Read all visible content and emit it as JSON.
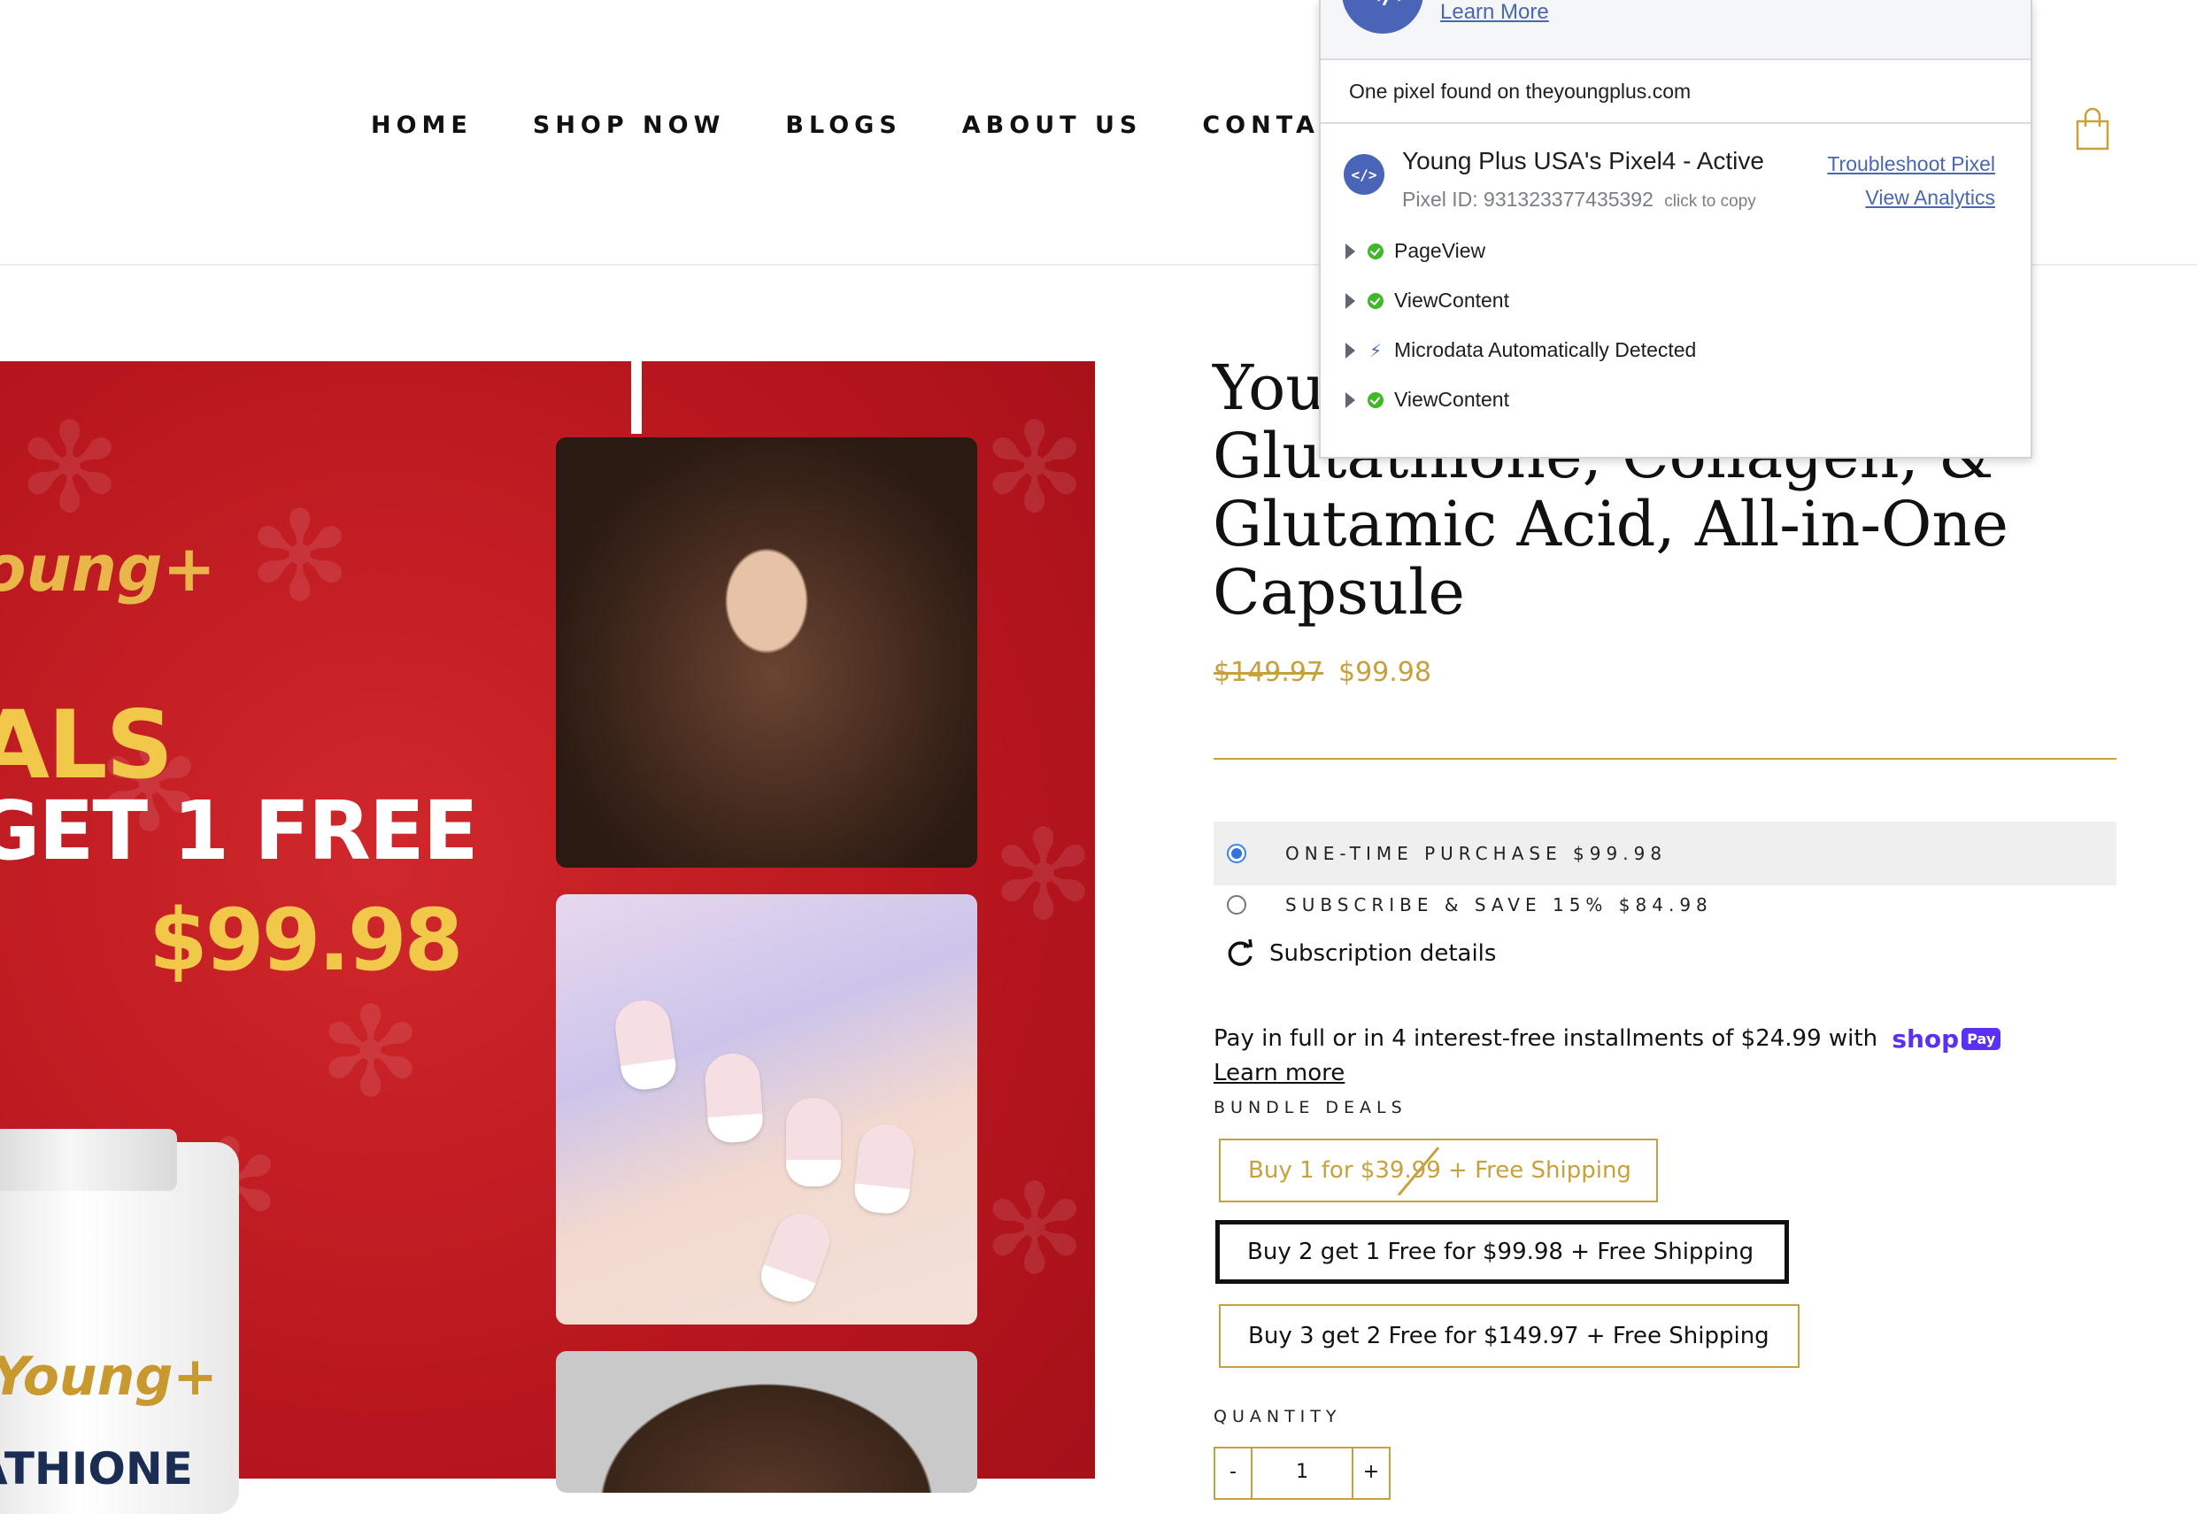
{
  "nav": {
    "items": [
      "HOME",
      "SHOP NOW",
      "BLOGS",
      "ABOUT US",
      "CONTACT U"
    ],
    "cart_icon": "shopping-bag-icon"
  },
  "hero": {
    "brand": "oung+",
    "deal_line1": "ALS",
    "deal_line2": "GET 1 FREE",
    "deal_price": "$99.98",
    "bottle_brand": "Young+",
    "bottle_label": "ATHIONE",
    "colors": {
      "background": "#c0201f",
      "accent": "#f2c84b"
    }
  },
  "product": {
    "title": "Young Plus Glutathione, Collagen, & Glutamic Acid, All-in-One Capsule",
    "title_visible_lines": [
      "You",
      "Glutathione, Collagen, &",
      "Glutamic Acid, All-in-One",
      "Capsule"
    ],
    "price_old": "$149.97",
    "price_new": "$99.98",
    "purchase_options": [
      {
        "label": "ONE-TIME PURCHASE $99.98",
        "selected": true
      },
      {
        "label": "SUBSCRIBE & SAVE 15% $84.98",
        "selected": false
      }
    ],
    "subscription_details": "Subscription details",
    "installments_text": "Pay in full or in 4 interest-free installments of $24.99 with",
    "shop_pay": {
      "shop": "shop",
      "pay": "Pay"
    },
    "learn_more": "Learn more",
    "bundle_label": "BUNDLE DEALS",
    "bundles": [
      {
        "label": "Buy 1 for $39.99 + Free Shipping",
        "selected": false
      },
      {
        "label": "Buy 2 get 1 Free for $99.98 + Free Shipping",
        "selected": true
      },
      {
        "label": "Buy 3 get 2 Free for $149.97 + Free Shipping",
        "selected": false
      }
    ],
    "quantity_label": "QUANTITY",
    "quantity": {
      "minus": "-",
      "value": "1",
      "plus": "+"
    },
    "accent_color": "#c9a13b"
  },
  "pixel_helper": {
    "learn_more": "Learn More",
    "found_text": "One pixel found on theyoungplus.com",
    "pixel_name": "Young Plus USA's Pixel4 - Active",
    "pixel_id_text": "Pixel ID: 931323377435392",
    "click_to_copy": "click to copy",
    "troubleshoot": "Troubleshoot Pixel",
    "view_analytics": "View Analytics",
    "events": [
      {
        "name": "PageView",
        "status": "ok"
      },
      {
        "name": "ViewContent",
        "status": "ok"
      },
      {
        "name": "Microdata Automatically Detected",
        "status": "info"
      },
      {
        "name": "ViewContent",
        "status": "ok"
      }
    ]
  }
}
